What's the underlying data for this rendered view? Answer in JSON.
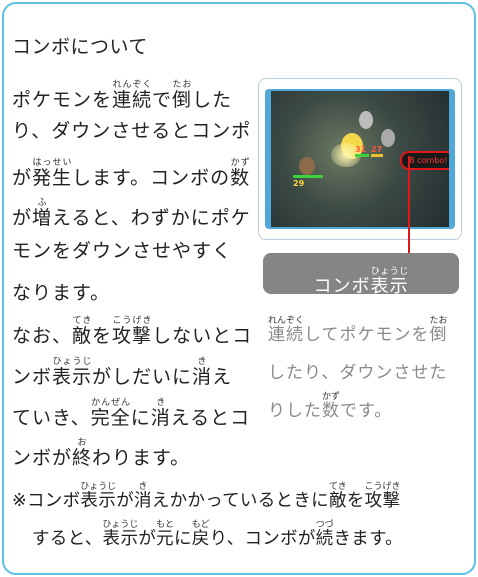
{
  "heading": "コンボについて",
  "body": {
    "l1": {
      "a": "ポケモンを",
      "b": "連続",
      "b_rt": "れんぞく",
      "c": "で",
      "d": "倒",
      "d_rt": "たお",
      "e": "した"
    },
    "l2": "り、ダウンさせるとコンポ",
    "l3": {
      "a": "が",
      "b": "発生",
      "b_rt": "はっせい",
      "c": "します。コンボの",
      "d": "数",
      "d_rt": "かず"
    },
    "l4": {
      "a": "が",
      "b": "増",
      "b_rt": "ふ",
      "c": "えると、わずかにポケ"
    },
    "l5": "モンをダウンさせやすく",
    "l6": "なります。",
    "l7": {
      "a": "なお、",
      "b": "敵",
      "b_rt": "てき",
      "c": "を",
      "d": "攻撃",
      "d_rt": "こうげき",
      "e": "しないとコ"
    },
    "l8": {
      "a": "ンボ",
      "b": "表示",
      "b_rt": "ひょうじ",
      "c": "がしだいに",
      "d": "消",
      "d_rt": "き",
      "e": "え"
    },
    "l9": {
      "a": "ていき、",
      "b": "完全",
      "b_rt": "かんぜん",
      "c": "に",
      "d": "消",
      "d_rt": "き",
      "e": "えるとコ"
    },
    "l10": {
      "a": "ンボが",
      "b": "終",
      "b_rt": "お",
      "c": "わります。"
    }
  },
  "note": {
    "l1": {
      "a": "※コンボ",
      "b": "表示",
      "b_rt": "ひょうじ",
      "c": "が",
      "d": "消",
      "d_rt": "き",
      "e": "えかかっているときに",
      "f": "敵",
      "f_rt": "てき",
      "g": "を",
      "h": "攻撃",
      "h_rt": "こうげき"
    },
    "l2": {
      "a": "すると、",
      "b": "表示",
      "b_rt": "ひょうじ",
      "c": "が",
      "d": "元",
      "d_rt": "もと",
      "e": "に",
      "f": "戻",
      "f_rt": "もど",
      "g": "り、コンボが",
      "h": "続",
      "h_rt": "つづ",
      "i": "きます。"
    }
  },
  "screenshot": {
    "combo_text": "8 combo!",
    "hp1": "31",
    "hp2": "27",
    "hp3": "29"
  },
  "label": {
    "text": "表示",
    "text_rt": "ひょうじ",
    "prefix": "コンボ"
  },
  "side": {
    "l1": {
      "a": "連続",
      "a_rt": "れんぞく",
      "b": "してポケモンを",
      "c": "倒",
      "c_rt": "たお"
    },
    "l2": "したり、ダウンさせた",
    "l3": {
      "a": "りした",
      "b": "数",
      "b_rt": "かず",
      "c": "です。"
    }
  },
  "colors": {
    "border": "#5fc0e6",
    "callout": "#e01818",
    "label_bg": "#858585"
  }
}
